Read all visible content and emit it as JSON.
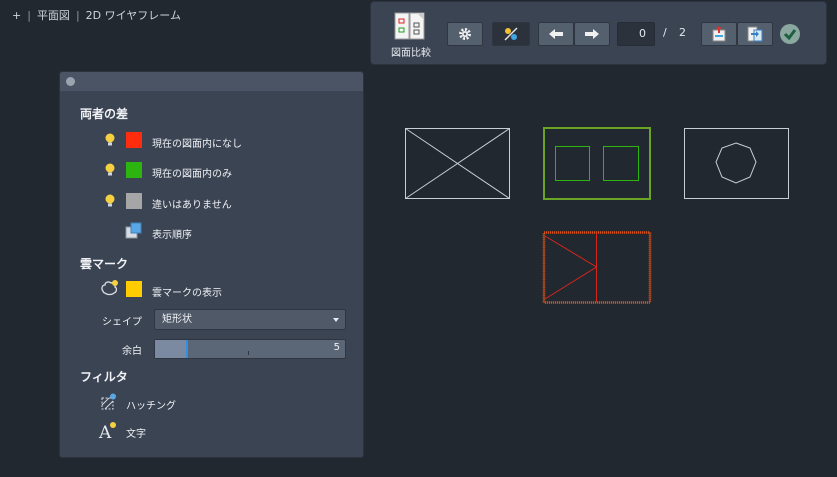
{
  "viewport": {
    "plus": "+",
    "view": "平面図",
    "style": "2D ワイヤフレーム"
  },
  "toolbar": {
    "compare_label": "図面比較",
    "current_page": "0",
    "slash": "/",
    "total_pages": "2"
  },
  "panel": {
    "diff_title": "両者の差",
    "diff_items": [
      {
        "label": "現在の図面内になし",
        "color": "#ff2d0d"
      },
      {
        "label": "現在の図面内のみ",
        "color": "#2cb50f"
      },
      {
        "label": "違いはありません",
        "color": "#a6a6a6"
      },
      {
        "label": "表示順序"
      }
    ],
    "cloud_title": "雲マーク",
    "cloud_show_label": "雲マークの表示",
    "cloud_color": "#ffcc00",
    "shape_label": "シェイプ",
    "shape_value": "矩形状",
    "margin_label": "余白",
    "margin_value": "5",
    "filter_title": "フィルタ",
    "hatch_label": "ハッチング",
    "text_label": "文字"
  }
}
